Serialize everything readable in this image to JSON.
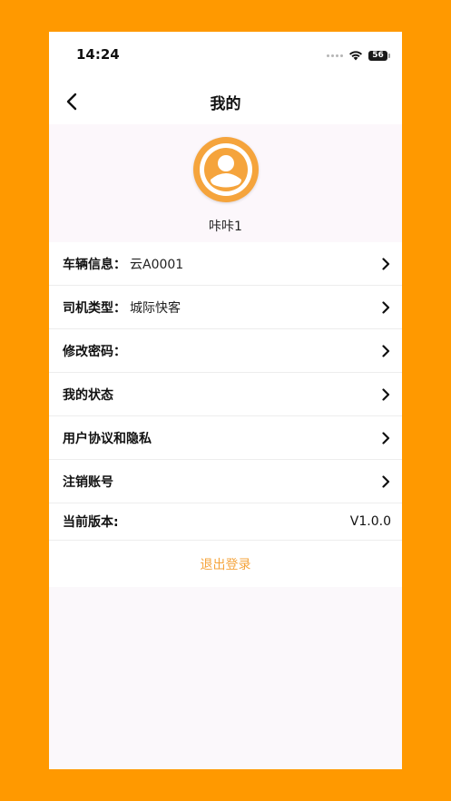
{
  "status_bar": {
    "time": "14:24",
    "battery": "56"
  },
  "nav": {
    "title": "我的"
  },
  "profile": {
    "username": "咔咔1"
  },
  "menu": [
    {
      "label": "车辆信息：",
      "value": "云A0001"
    },
    {
      "label": "司机类型：",
      "value": "城际快客"
    },
    {
      "label": "修改密码：",
      "value": ""
    },
    {
      "label": "我的状态",
      "value": ""
    },
    {
      "label": "用户协议和隐私",
      "value": ""
    },
    {
      "label": "注销账号",
      "value": ""
    }
  ],
  "version": {
    "label": "当前版本:",
    "value": "V1.0.0"
  },
  "logout_label": "退出登录",
  "colors": {
    "accent": "#F5A43C",
    "frame": "#FF9900"
  }
}
